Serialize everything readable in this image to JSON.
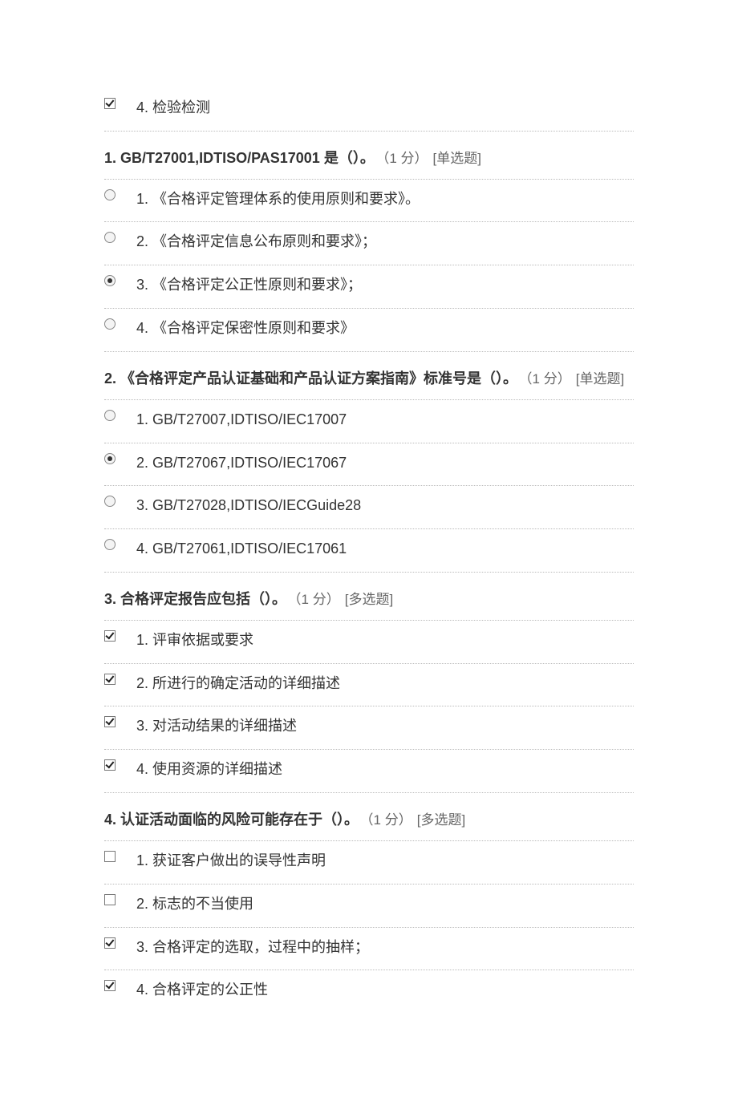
{
  "orphan_option": {
    "text": "4. 检验检测",
    "checked": true
  },
  "questions": [
    {
      "num": "1.",
      "title": "GB/T27001,IDTISO/PAS17001 是（）。",
      "points": "（1 分）",
      "type_tag": "[单选题]",
      "input": "radio",
      "options": [
        {
          "text": "1. 《合格评定管理体系的使用原则和要求》。",
          "checked": false
        },
        {
          "text": "2. 《合格评定信息公布原则和要求》；",
          "checked": false
        },
        {
          "text": "3. 《合格评定公正性原则和要求》；",
          "checked": true
        },
        {
          "text": "4. 《合格评定保密性原则和要求》",
          "checked": false
        }
      ]
    },
    {
      "num": "2.",
      "title": "《合格评定产品认证基础和产品认证方案指南》标准号是（）。",
      "points": "（1 分）",
      "type_tag": "[单选题]",
      "input": "radio",
      "options": [
        {
          "text": "1. GB/T27007,IDTISO/IEC17007",
          "checked": false
        },
        {
          "text": "2. GB/T27067,IDTISO/IEC17067",
          "checked": true
        },
        {
          "text": "3. GB/T27028,IDTISO/IECGuide28",
          "checked": false
        },
        {
          "text": "4. GB/T27061,IDTISO/IEC17061",
          "checked": false
        }
      ]
    },
    {
      "num": "3.",
      "title": "合格评定报告应包括（）。",
      "points": "（1 分）",
      "type_tag": "[多选题]",
      "input": "checkbox",
      "options": [
        {
          "text": "1. 评审依据或要求",
          "checked": true
        },
        {
          "text": "2. 所进行的确定活动的详细描述",
          "checked": true
        },
        {
          "text": "3. 对活动结果的详细描述",
          "checked": true
        },
        {
          "text": "4. 使用资源的详细描述",
          "checked": true
        }
      ]
    },
    {
      "num": "4.",
      "title": "认证活动面临的风险可能存在于（）。",
      "points": "（1 分）",
      "type_tag": "[多选题]",
      "input": "checkbox",
      "options": [
        {
          "text": "1. 获证客户做出的误导性声明",
          "checked": false
        },
        {
          "text": "2. 标志的不当使用",
          "checked": false
        },
        {
          "text": "3. 合格评定的选取，过程中的抽样；",
          "checked": true
        },
        {
          "text": "4. 合格评定的公正性",
          "checked": true
        }
      ]
    }
  ]
}
